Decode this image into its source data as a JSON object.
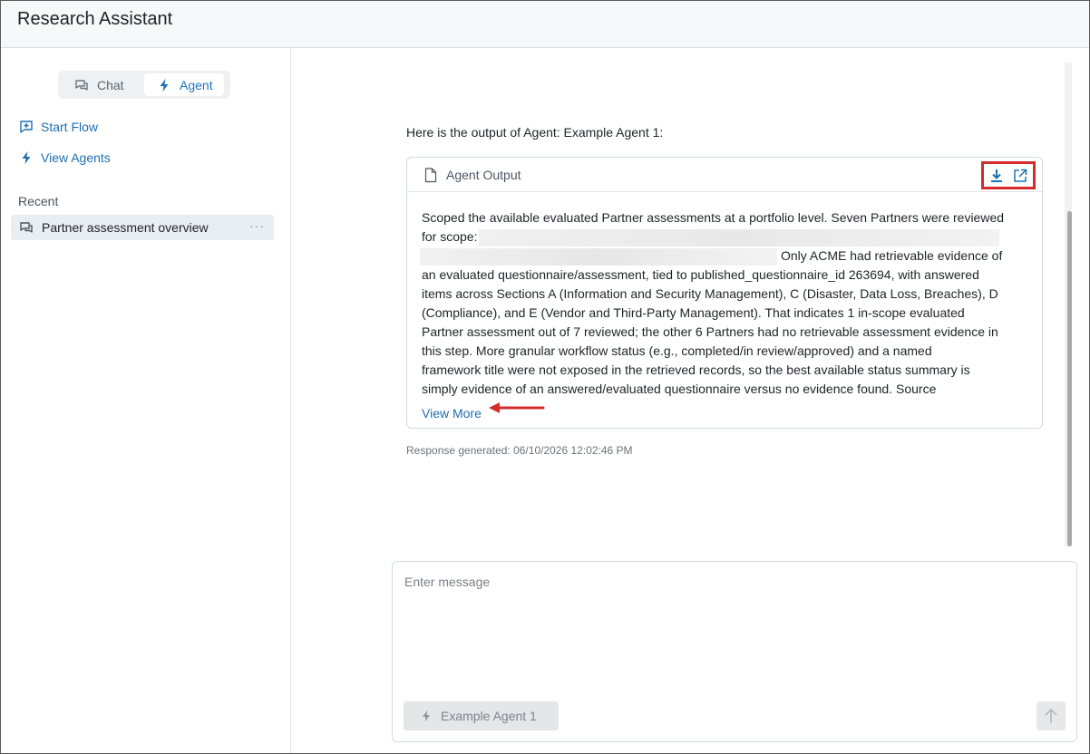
{
  "app": {
    "title": "Research Assistant"
  },
  "mode_toggle": {
    "chat_label": "Chat",
    "agent_label": "Agent",
    "selected": "Agent"
  },
  "sidebar": {
    "links": [
      {
        "label": "Start Flow",
        "icon": "plus-message-icon"
      },
      {
        "label": "View Agents",
        "icon": "lightning-icon"
      }
    ],
    "recent_label": "Recent",
    "recent_items": [
      {
        "label": "Partner assessment overview",
        "more": "···"
      }
    ]
  },
  "conversation": {
    "intro": "Here is the output of Agent: Example Agent 1:",
    "card": {
      "title": "Agent Output",
      "lines": [
        "Scoped the available evaluated Partner assessments at a portfolio level. Seven Partners were reviewed",
        "for scope:",
        "Only ACME had retrievable evidence of",
        "an evaluated questionnaire/assessment, tied to published_questionnaire_id 263694, with answered",
        "items across Sections A (Information and Security Management), C (Disaster, Data Loss, Breaches), D",
        "(Compliance), and E (Vendor and Third-Party Management). That indicates 1 in-scope evaluated",
        "Partner assessment out of 7 reviewed; the other 6 Partners had no retrievable assessment evidence in",
        "this step. More granular workflow status (e.g., completed/in review/approved) and a named",
        "framework title were not exposed in the retrieved records, so the best available status summary is",
        "simply evidence of an answered/evaluated questionnaire versus no evidence found. Source"
      ],
      "view_more": "View More"
    },
    "response_generated": "Response generated: 06/10/2026 12:02:46 PM"
  },
  "composer": {
    "placeholder": "Enter message",
    "agent_chip": "Example Agent 1"
  },
  "colors": {
    "accent": "#1e6fb0",
    "highlight": "#d62b2b"
  }
}
